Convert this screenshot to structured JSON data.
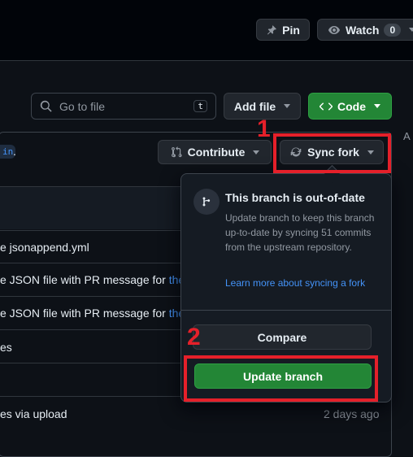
{
  "header": {
    "pin_label": "Pin",
    "watch_label": "Watch",
    "watch_count": "0"
  },
  "toolbar": {
    "search_placeholder": "Go to file",
    "search_shortcut": "t",
    "add_file_label": "Add file",
    "code_label": "Code"
  },
  "branch_bar": {
    "branch_chip": "in",
    "trailing_text": ".",
    "contribute_label": "Contribute",
    "sync_fork_label": "Sync fork"
  },
  "file_rows": [
    {
      "prefix": "e jsonappend.yml",
      "link": ""
    },
    {
      "prefix": "e JSON file with PR message for ",
      "link": "theI"
    },
    {
      "prefix": "e JSON file with PR message for ",
      "link": "theI"
    },
    {
      "prefix": "es",
      "link": ""
    },
    {
      "prefix": "",
      "link": ""
    },
    {
      "prefix": "es via upload",
      "link": "",
      "time": "2 days ago"
    }
  ],
  "popover": {
    "title": "This branch is out-of-date",
    "body": "Update branch to keep this branch up-to-date by syncing 51 commits from the upstream repository.",
    "learn_more": "Learn more about syncing a fork",
    "compare_label": "Compare",
    "update_label": "Update branch"
  },
  "annotations": {
    "step1": "1",
    "step2": "2",
    "color": "#e5202a"
  },
  "colors": {
    "background": "#0d1117",
    "green_button": "#238636",
    "link": "#4493f8"
  }
}
